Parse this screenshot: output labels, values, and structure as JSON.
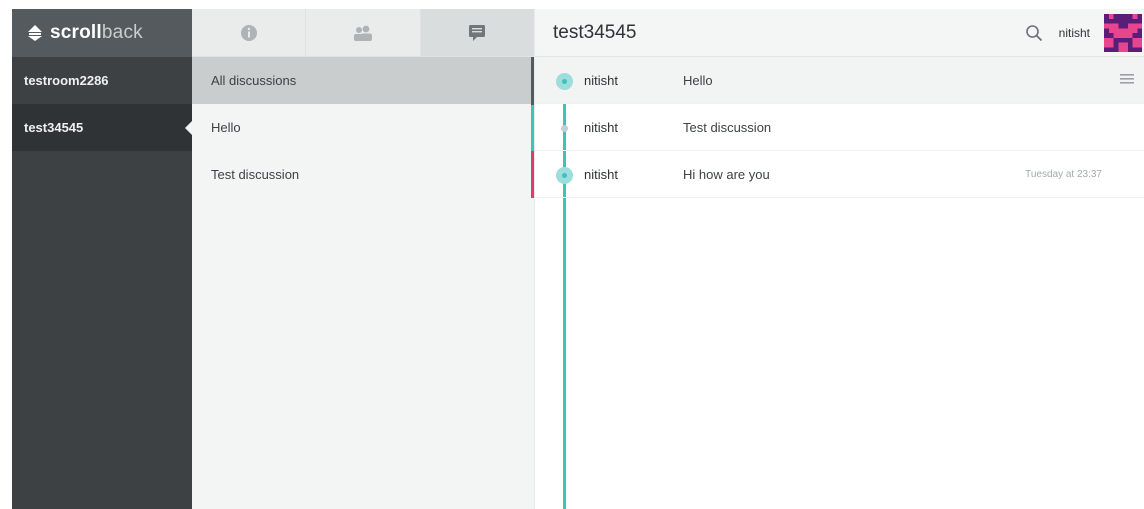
{
  "brand": {
    "bold": "scroll",
    "light": "back"
  },
  "sidebar": {
    "rooms": [
      {
        "label": "testroom2286",
        "active": false
      },
      {
        "label": "test34545",
        "active": true
      }
    ]
  },
  "middle": {
    "tabs": [
      {
        "icon": "info-icon"
      },
      {
        "icon": "people-icon"
      },
      {
        "icon": "discussions-icon"
      }
    ],
    "discussions": [
      "All discussions",
      "Hello",
      "Test discussion"
    ]
  },
  "chat": {
    "title": "test34545",
    "user": "nitisht",
    "messages": [
      {
        "user": "nitisht",
        "text": "Hello",
        "time": ""
      },
      {
        "user": "nitisht",
        "text": "Test discussion",
        "time": ""
      },
      {
        "user": "nitisht",
        "text": "Hi how are you",
        "time": "Tuesday at 23:37"
      }
    ]
  },
  "colors": {
    "accent": "#3fc1bd",
    "alert": "#e2396f",
    "sidebar": "#3d4144",
    "avatar_bg": "#5a1d7a",
    "avatar_fg": "#e8458f"
  }
}
